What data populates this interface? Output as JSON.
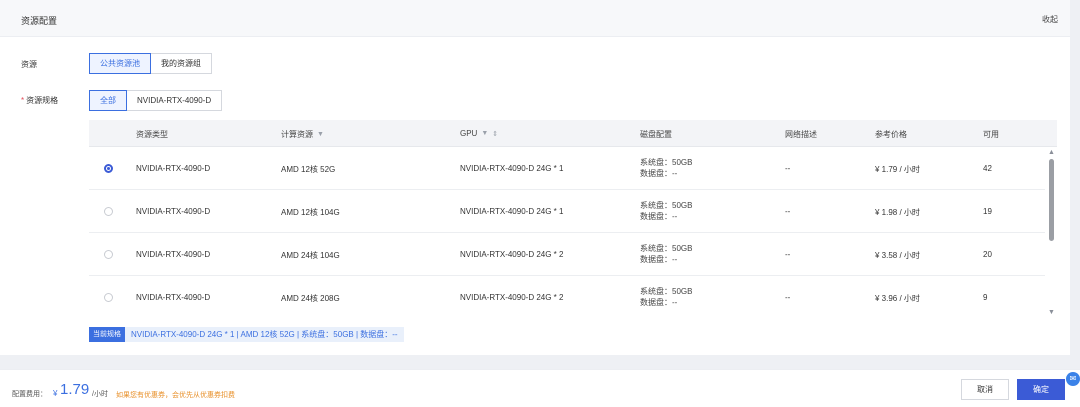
{
  "header": {
    "title": "资源配置",
    "collapse_label": "收起"
  },
  "form": {
    "resource_label": "资源",
    "resource_tabs": [
      {
        "label": "公共资源池",
        "active": true
      },
      {
        "label": "我的资源组",
        "active": false
      }
    ],
    "spec_required_mark": "*",
    "spec_label": "资源规格",
    "spec_tabs": [
      {
        "label": "全部",
        "active": true
      },
      {
        "label": "NVIDIA-RTX-4090-D",
        "active": false
      }
    ]
  },
  "table": {
    "columns": [
      "资源类型",
      "计算资源",
      "GPU",
      "磁盘配置",
      "网络描述",
      "参考价格",
      "可用"
    ],
    "rows": [
      {
        "selected": true,
        "type": "NVIDIA-RTX-4090-D",
        "compute": "AMD 12核 52G",
        "gpu": "NVIDIA-RTX-4090-D 24G * 1",
        "sys_disk": "系统盘：50GB",
        "data_disk": "数据盘：--",
        "network": "--",
        "price": "¥ 1.79 / 小时",
        "available": "42"
      },
      {
        "selected": false,
        "type": "NVIDIA-RTX-4090-D",
        "compute": "AMD 12核 104G",
        "gpu": "NVIDIA-RTX-4090-D 24G * 1",
        "sys_disk": "系统盘：50GB",
        "data_disk": "数据盘：--",
        "network": "--",
        "price": "¥ 1.98 / 小时",
        "available": "19"
      },
      {
        "selected": false,
        "type": "NVIDIA-RTX-4090-D",
        "compute": "AMD 24核 104G",
        "gpu": "NVIDIA-RTX-4090-D 24G * 2",
        "sys_disk": "系统盘：50GB",
        "data_disk": "数据盘：--",
        "network": "--",
        "price": "¥ 3.58 / 小时",
        "available": "20"
      },
      {
        "selected": false,
        "type": "NVIDIA-RTX-4090-D",
        "compute": "AMD 24核 208G",
        "gpu": "NVIDIA-RTX-4090-D 24G * 2",
        "sys_disk": "系统盘：50GB",
        "data_disk": "数据盘：--",
        "network": "--",
        "price": "¥ 3.96 / 小时",
        "available": "9"
      }
    ]
  },
  "current_spec": {
    "badge": "当前规格",
    "text": "NVIDIA-RTX-4090-D 24G * 1 | AMD 12核 52G | 系统盘：50GB | 数据盘：--"
  },
  "footer": {
    "fee_label": "配置费用：",
    "currency": "¥",
    "amount": "1.79",
    "unit": "/小时",
    "tip": "如果您有优惠券，会优先从优惠券扣费",
    "cancel_label": "取消",
    "confirm_label": "确定"
  },
  "icons": {
    "filter": "filter-icon",
    "sort": "sort-icon",
    "scroll_up": "chevron-up-icon",
    "scroll_down": "chevron-down-icon",
    "helper": "chat-bubble-icon"
  },
  "colors": {
    "accent": "#3b6fe0",
    "primary_button": "#3b5bd6",
    "tip": "#e8902a",
    "required": "#e34d59"
  }
}
